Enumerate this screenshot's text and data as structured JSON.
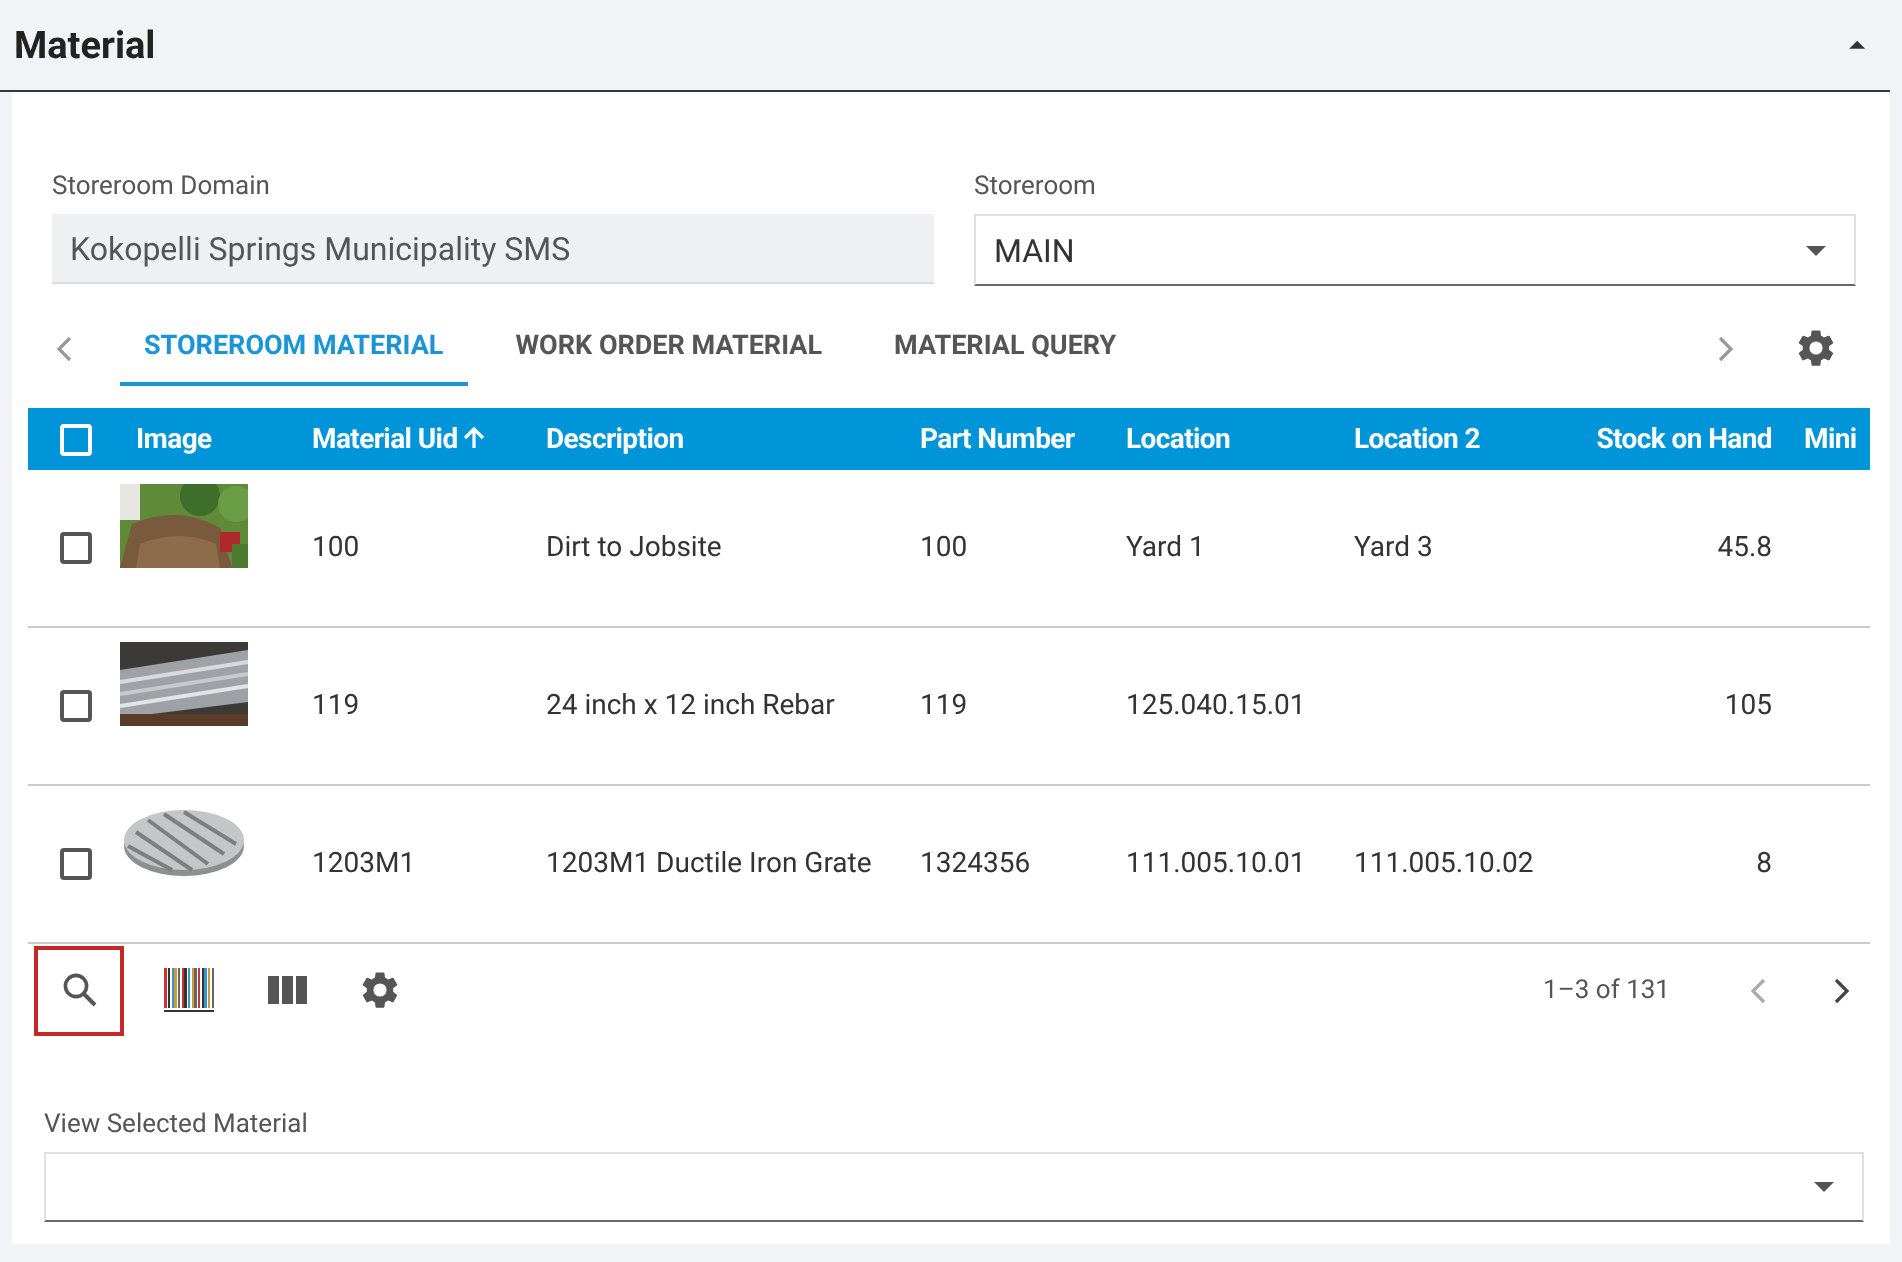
{
  "panel": {
    "title": "Material",
    "collapse_icon": "⏶"
  },
  "fields": [
    {
      "label": "Storeroom Domain",
      "value": "Kokopelli Springs Municipality SMS",
      "kind": "readonly"
    },
    {
      "label": "Storeroom",
      "value": "MAIN",
      "kind": "select"
    }
  ],
  "tabs": [
    {
      "label": "STOREROOM MATERIAL",
      "selected": true
    },
    {
      "label": "WORK ORDER MATERIAL",
      "selected": false
    },
    {
      "label": "MATERIAL QUERY",
      "selected": false
    }
  ],
  "table": {
    "select_all_checked": false,
    "columns": [
      {
        "label": "Image",
        "sorted": false
      },
      {
        "label": "Material Uid",
        "sorted": true,
        "kind": "text"
      },
      {
        "label": "Description",
        "sorted": false,
        "kind": "text"
      },
      {
        "label": "Part Number",
        "sorted": false,
        "kind": "text"
      },
      {
        "label": "Location",
        "sorted": false,
        "kind": "text"
      },
      {
        "label": "Location 2",
        "sorted": false,
        "kind": "text"
      },
      {
        "label": "Stock on Hand",
        "sorted": false,
        "kind": "number"
      },
      {
        "label": "Mini",
        "sorted": false,
        "kind": "text"
      }
    ],
    "rows": [
      {
        "checked": false,
        "cells": [
          "",
          "100",
          "Dirt to Jobsite",
          "100",
          "Yard 1",
          "Yard 3",
          "45.8",
          ""
        ]
      },
      {
        "checked": false,
        "cells": [
          "",
          "119",
          "24 inch x 12 inch Rebar",
          "119",
          "125.040.15.01",
          "",
          "105",
          ""
        ]
      },
      {
        "checked": false,
        "cells": [
          "",
          "1203M1",
          "1203M1 Ductile Iron Grate",
          "1324356",
          "111.005.10.01",
          "111.005.10.02",
          "8",
          ""
        ]
      }
    ]
  },
  "toolbar": [
    {
      "kind": "search",
      "selected": true
    },
    {
      "kind": "barcode",
      "selected": false
    },
    {
      "kind": "columns",
      "selected": false
    },
    {
      "kind": "settings",
      "selected": false
    }
  ],
  "pagination": {
    "range": "1–3 of 131"
  },
  "view_selected": {
    "label": "View Selected Material"
  }
}
